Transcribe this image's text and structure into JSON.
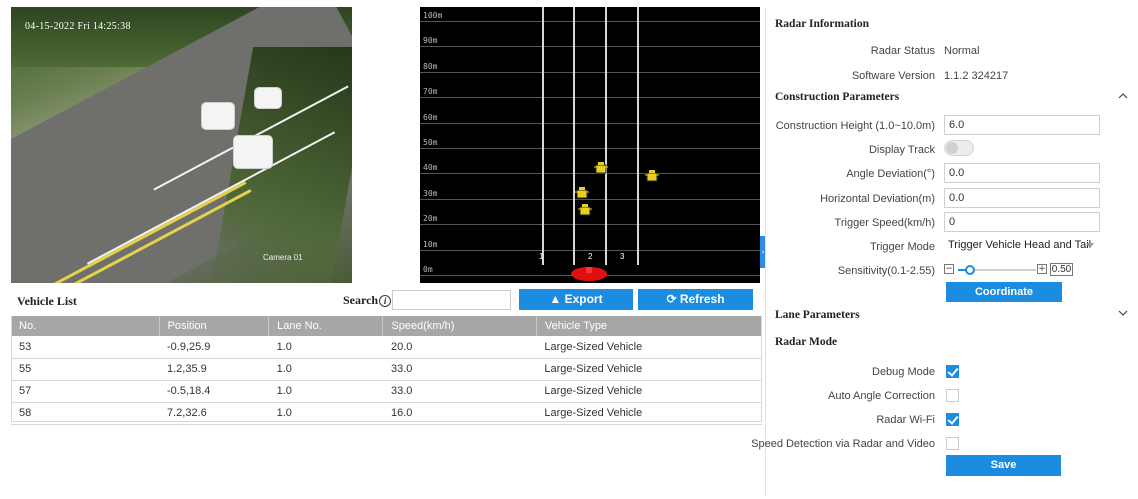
{
  "camera": {
    "osd_text": "04-15-2022 Fri 14:25:38",
    "watermark": "Camera 01"
  },
  "radar_view": {
    "distance_labels": [
      "100m",
      "90m",
      "80m",
      "70m",
      "60m",
      "50m",
      "40m",
      "30m",
      "20m",
      "10m",
      "0m"
    ],
    "lane_numbers": [
      "1",
      "2",
      "3"
    ],
    "target_color": "#e8d020",
    "origin_color": "#e01010"
  },
  "vehicle_list": {
    "title": "Vehicle List",
    "search_label": "Search",
    "search_info_icon": "info-icon",
    "search_value": "",
    "export_label": "Export",
    "refresh_label": "Refresh",
    "columns": [
      "No.",
      "Position",
      "Lane No.",
      "Speed(km/h)",
      "Vehicle Type"
    ],
    "rows": [
      [
        "53",
        "-0.9,25.9",
        "1.0",
        "20.0",
        "Large-Sized Vehicle"
      ],
      [
        "55",
        "1.2,35.9",
        "1.0",
        "33.0",
        "Large-Sized Vehicle"
      ],
      [
        "57",
        "-0.5,18.4",
        "1.0",
        "33.0",
        "Large-Sized Vehicle"
      ],
      [
        "58",
        "7.2,32.6",
        "1.0",
        "16.0",
        "Large-Sized Vehicle"
      ]
    ]
  },
  "panel": {
    "radar_info_title": "Radar Information",
    "radar_status_label": "Radar Status",
    "radar_status_value": "Normal",
    "software_version_label": "Software Version",
    "software_version_value": "1.1.2 324217",
    "construction_title": "Construction Parameters",
    "construction_height_label": "Construction Height (1.0~10.0m)",
    "construction_height_value": "6.0",
    "display_track_label": "Display Track",
    "display_track_on": false,
    "angle_deviation_label": "Angle Deviation(°)",
    "angle_deviation_value": "0.0",
    "horizontal_deviation_label": "Horizontal Deviation(m)",
    "horizontal_deviation_value": "0.0",
    "trigger_speed_label": "Trigger Speed(km/h)",
    "trigger_speed_value": "0",
    "trigger_mode_label": "Trigger Mode",
    "trigger_mode_value": "Trigger Vehicle Head and Tail",
    "sensitivity_label": "Sensitivity(0.1-2.55)",
    "sensitivity_value": "0.50",
    "sensitivity_fraction": 0.16,
    "coordinate_calibration_label": "Coordinate Calibration",
    "lane_params_title": "Lane Parameters",
    "radar_mode_title": "Radar Mode",
    "debug_mode_label": "Debug Mode",
    "debug_mode_checked": true,
    "auto_angle_label": "Auto Angle Correction",
    "auto_angle_checked": false,
    "radar_wifi_label": "Radar Wi-Fi",
    "radar_wifi_checked": true,
    "speed_detection_label": "Speed Detection via Radar and Video",
    "speed_detection_checked": false,
    "save_label": "Save"
  },
  "colors": {
    "accent": "#1b8ce0",
    "table_header": "#a7a7a7"
  }
}
